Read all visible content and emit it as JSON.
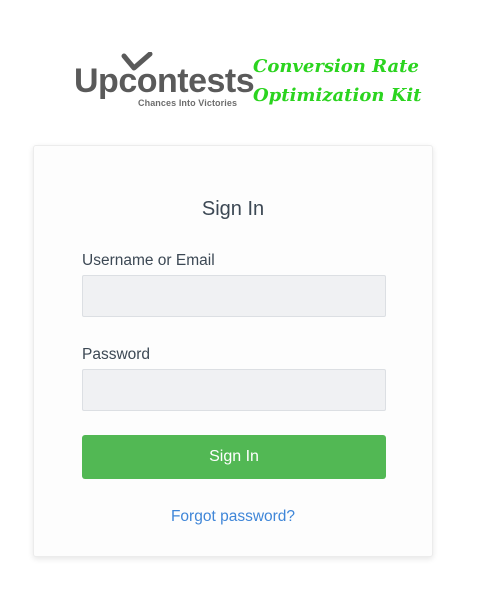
{
  "brand": {
    "logo_prefix": "Up",
    "logo_suffix": "ontests",
    "logo_middle": "c",
    "tagline": "Chances Into Victories",
    "kit_title_line1": "Conversion Rate",
    "kit_title_line2": "Optimization Kit",
    "kit_color": "#2bd41f",
    "logo_color": "#5a5a5a"
  },
  "form": {
    "title": "Sign In",
    "username_label": "Username or Email",
    "username_value": "",
    "password_label": "Password",
    "password_value": "",
    "submit_label": "Sign In",
    "forgot_label": "Forgot password?",
    "button_color": "#52b854",
    "link_color": "#3f86d8"
  }
}
